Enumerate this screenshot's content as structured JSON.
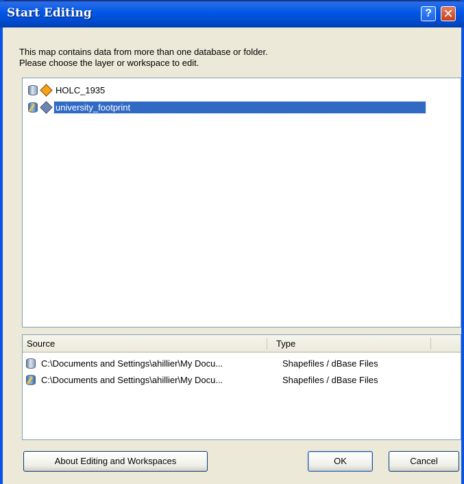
{
  "window": {
    "title": "Start Editing"
  },
  "titlebar_buttons": {
    "help": "?",
    "close": "✕"
  },
  "message": {
    "line1": "This map contains data from more than one database or folder.",
    "line2": "Please choose the layer or workspace to edit."
  },
  "tree": {
    "items": [
      {
        "label": "HOLC_1935",
        "db_icon": "database-icon",
        "layer_icon": "layer-icon-orange",
        "selected": false
      },
      {
        "label": "university_footprint",
        "db_icon": "editable-database-icon",
        "layer_icon": "layer-icon-blue",
        "selected": true
      }
    ]
  },
  "list": {
    "columns": [
      "Source",
      "Type"
    ],
    "rows": [
      {
        "source": "C:\\Documents and Settings\\ahillier\\My Docu...",
        "type": "Shapefiles / dBase Files",
        "icon": "database-icon"
      },
      {
        "source": "C:\\Documents and Settings\\ahillier\\My Docu...",
        "type": "Shapefiles / dBase Files",
        "icon": "editable-database-icon"
      }
    ]
  },
  "buttons": {
    "about": "About Editing and Workspaces",
    "ok": "OK",
    "cancel": "Cancel"
  },
  "colors": {
    "titlebar": "#0058e6",
    "selection": "#316ac5",
    "dialog_bg": "#ece9d8"
  }
}
